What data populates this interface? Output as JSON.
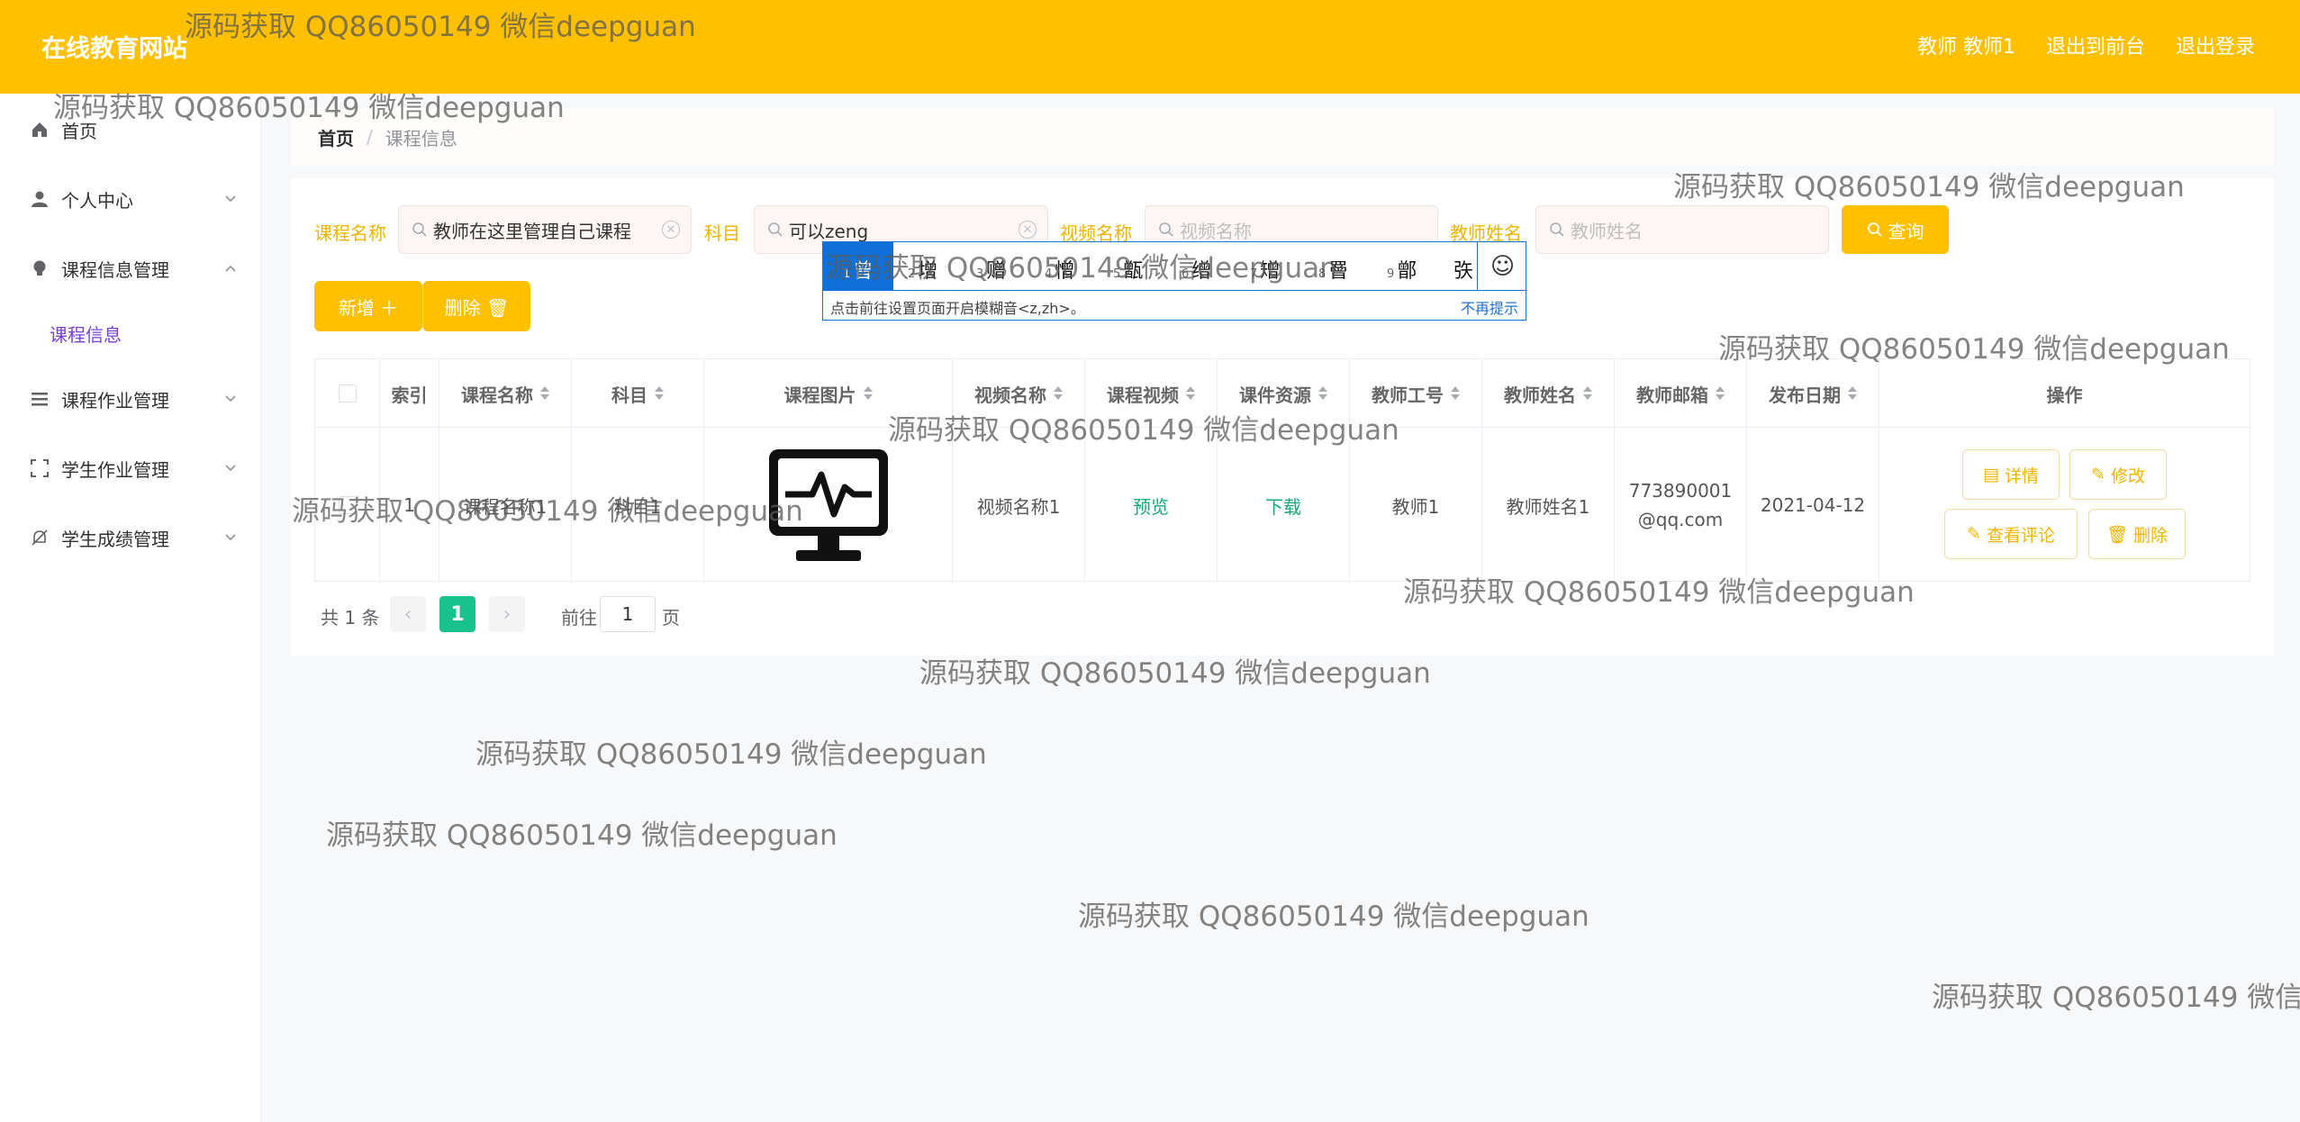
{
  "header": {
    "brand": "在线教育网站",
    "user_label": "教师 教师1",
    "to_front_label": "退出到前台",
    "logout_label": "退出登录"
  },
  "sidebar": {
    "items": [
      {
        "label": "首页",
        "icon": "home-icon"
      },
      {
        "label": "个人中心",
        "icon": "user-icon"
      },
      {
        "label": "课程信息管理",
        "icon": "bulb-icon"
      },
      {
        "label": "课程作业管理",
        "icon": "list-icon"
      },
      {
        "label": "学生作业管理",
        "icon": "dashed-box-icon"
      },
      {
        "label": "学生成绩管理",
        "icon": "bell-off-icon"
      }
    ],
    "sub_item": "课程信息"
  },
  "breadcrumb": {
    "home": "首页",
    "sep": "/",
    "current": "课程信息"
  },
  "filters": {
    "course_name_label": "课程名称",
    "course_name_value": "教师在这里管理自己课程",
    "subject_label": "科目",
    "subject_value": "可以zeng",
    "video_name_label": "视频名称",
    "video_name_placeholder": "视频名称",
    "teacher_name_label": "教师姓名",
    "teacher_name_placeholder": "教师姓名",
    "search_label": "查询"
  },
  "actions": {
    "add_label": "新增 ＋",
    "delete_label": "删除 🗑"
  },
  "ime": {
    "candidates": [
      {
        "n": "1",
        "c": "曾"
      },
      {
        "n": "2",
        "c": "增"
      },
      {
        "n": "3",
        "c": "赠"
      },
      {
        "n": "4",
        "c": "憎"
      },
      {
        "n": "5",
        "c": "甑"
      },
      {
        "n": "6",
        "c": "缯"
      },
      {
        "n": "7",
        "c": "矰"
      },
      {
        "n": "8",
        "c": "罾"
      },
      {
        "n": "9",
        "c": "鄫"
      },
      {
        "n": "",
        "c": "矤"
      }
    ],
    "emoji": "☺",
    "hint": "点击前往设置页面开启模糊音<z,zh>。",
    "dismiss": "不再提示"
  },
  "table": {
    "headers": [
      "",
      "索引",
      "课程名称",
      "科目",
      "课程图片",
      "视频名称",
      "课程视频",
      "课件资源",
      "教师工号",
      "教师姓名",
      "教师邮箱",
      "发布日期",
      "操作"
    ],
    "row": {
      "index": "1",
      "course_name": "课程名称1",
      "subject": "科目1",
      "video_name": "视频名称1",
      "video": "预览",
      "courseware": "下载",
      "teacher_no": "教师1",
      "teacher_name": "教师姓名1",
      "email_line1": "773890001",
      "email_line2": "@qq.com",
      "date": "2021-04-12"
    },
    "ops": {
      "detail": "详情",
      "edit": "修改",
      "comments": "查看评论",
      "delete": "删除"
    }
  },
  "pagination": {
    "total": "共 1 条",
    "page": "1",
    "goto": "前往",
    "goto_value": "1",
    "unit": "页"
  },
  "watermark": "源码获取 QQ86050149 微信deepguan",
  "watermark_partial": "源码获取 QQ86050149 微信d"
}
